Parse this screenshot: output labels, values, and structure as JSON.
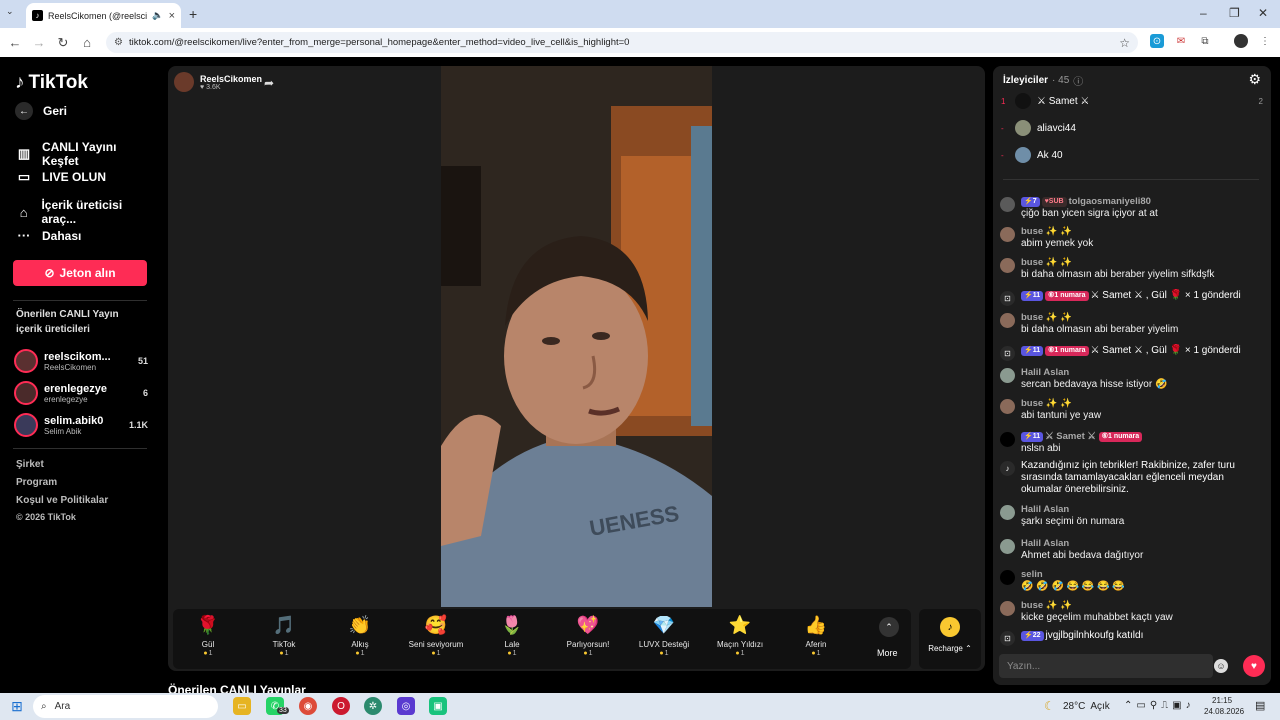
{
  "browser": {
    "tab_title": "ReelsCikomen (@reelscikomen",
    "url": "tiktok.com/@reelscikomen/live?enter_from_merge=personal_homepage&enter_method=video_live_cell&is_highlight=0"
  },
  "sidebar": {
    "logo": "TikTok",
    "back_label": "Geri",
    "nav": [
      {
        "label": "CANLI Yayını Keşfet",
        "icon": "live-explore-icon"
      },
      {
        "label": "LIVE OLUN",
        "icon": "video-camera-icon"
      },
      {
        "label": "İçerik üreticisi araç...",
        "icon": "creator-tools-icon"
      },
      {
        "label": "Dahası",
        "icon": "more-dots-icon"
      }
    ],
    "jeton_label": "Jeton alın",
    "suggested_title": "Önerilen CANLI Yayın içerik üreticileri",
    "creators": [
      {
        "name": "reelscikom...",
        "handle": "ReelsCikomen",
        "count": "51"
      },
      {
        "name": "erenlegezye",
        "handle": "erenlegezye",
        "count": "6"
      },
      {
        "name": "selim.abik0",
        "handle": "Selim Abik",
        "count": "1.1K"
      }
    ],
    "footer": [
      "Şirket",
      "Program",
      "Koşul ve Politikalar",
      "© 2026 TikTok"
    ]
  },
  "stage": {
    "host_name": "ReelsCikomen",
    "host_likes": "3.6K",
    "gifts": [
      {
        "name": "Gül",
        "price": "1",
        "icon": "🌹"
      },
      {
        "name": "TikTok",
        "price": "1",
        "icon": "🎵"
      },
      {
        "name": "Alkış",
        "price": "1",
        "icon": "👏"
      },
      {
        "name": "Seni seviyorum",
        "price": "1",
        "icon": "🥰"
      },
      {
        "name": "Lale",
        "price": "1",
        "icon": "🌷"
      },
      {
        "name": "Parlıyorsun!",
        "price": "1",
        "icon": "💖"
      },
      {
        "name": "LUVX Desteği",
        "price": "1",
        "icon": "💎"
      },
      {
        "name": "Maçın Yıldızı",
        "price": "1",
        "icon": "⭐"
      },
      {
        "name": "Aferin",
        "price": "1",
        "icon": "👍"
      }
    ],
    "more_label": "More",
    "recharge_label": "Recharge",
    "below_title": "Önerilen CANLI Yayınlar"
  },
  "chat": {
    "viewers_label": "İzleyiciler",
    "viewers_count": "· 45",
    "top_viewers": [
      {
        "rank": "1",
        "name": "⚔ Samet ⚔",
        "score": "2",
        "color": "#111111"
      },
      {
        "rank": "-",
        "name": "aliavci44",
        "score": "",
        "color": "#8a8f78"
      },
      {
        "rank": "-",
        "name": "Ak 40",
        "score": "",
        "color": "#6f8ea8"
      }
    ],
    "messages": [
      {
        "user": "tolgaosmaniyeli80",
        "text": "çiğo ban yicen sigra içiyor at at",
        "level": "7",
        "sub": "SUB"
      },
      {
        "user": "buse ✨ ✨",
        "text": "abim yemek yok"
      },
      {
        "user": "buse ✨ ✨",
        "text": "bi daha olmasın abi beraber yiyelim sifkdşfk"
      },
      {
        "system": "⚔ Samet ⚔  , Gül 🌹 × 1 gönderdi",
        "level": "11",
        "num": "1 numara"
      },
      {
        "user": "buse ✨ ✨",
        "text": "bi daha olmasın abi beraber yiyelim"
      },
      {
        "system": "⚔ Samet ⚔  , Gül 🌹 × 1 gönderdi",
        "level": "11",
        "num": "1 numara"
      },
      {
        "user": "Halil Aslan",
        "text": "sercan bedavaya hisse istiyor 🤣"
      },
      {
        "user": "buse ✨ ✨",
        "text": "abi tantuni ye yaw"
      },
      {
        "user": "⚔ Samet ⚔",
        "text": "nslsn abi",
        "level": "11",
        "num": "1 numara"
      },
      {
        "system": "Kazandığınız için tebrikler! Rakibinize, zafer turu sırasında tamamlayacakları eğlenceli meydan okumalar önerebilirsiniz."
      },
      {
        "user": "Halil Aslan",
        "text": "şarkı seçimi ön numara"
      },
      {
        "user": "Halil Aslan",
        "text": "Ahmet abi bedava dağıtıyor"
      },
      {
        "user": "selin",
        "text": "🤣 🤣 🤣 😂 😂 😂 😂"
      },
      {
        "user": "buse ✨ ✨",
        "text": "kicke geçelim muhabbet kaçtı yaw"
      },
      {
        "system": "jvgjlbgilnhkoufg  katıldı",
        "level": "22"
      }
    ],
    "input_placeholder": "Yazın..."
  },
  "taskbar": {
    "search_label": "Ara",
    "whatsapp_badge": "33",
    "weather": "28°C  Açık",
    "time": "21:15",
    "date": "24.08.2026"
  }
}
